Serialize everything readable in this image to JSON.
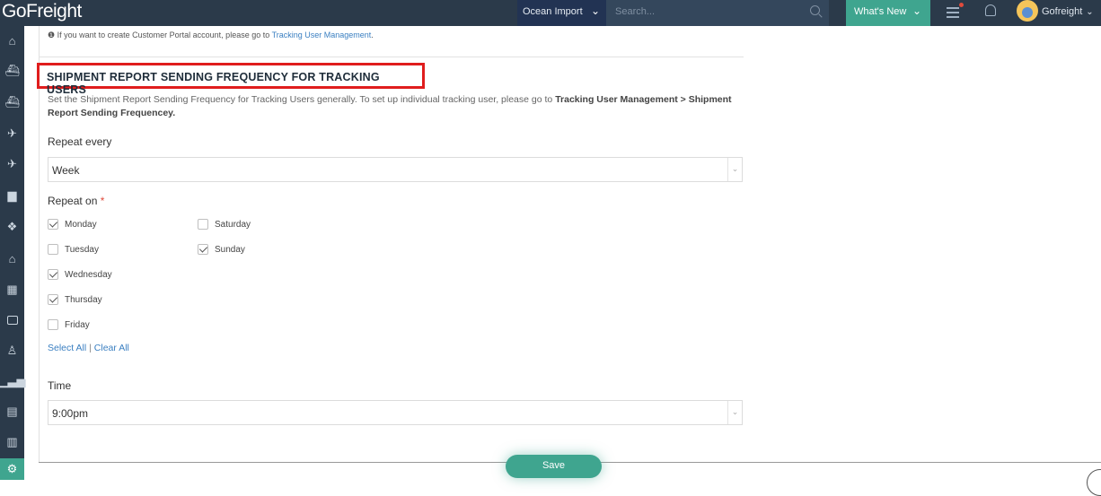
{
  "app": {
    "logo": "GoFreight"
  },
  "header": {
    "mode": "Ocean Import",
    "search_placeholder": "Search...",
    "whats_new": "What's New",
    "username": "Gofreight"
  },
  "sidebar": {
    "items": [
      "home-icon",
      "ocean-export-icon",
      "ocean-import-icon",
      "air-export-icon",
      "air-import-icon",
      "truck-icon",
      "warehouse-icon",
      "building-icon",
      "calculator-icon",
      "briefcase-icon",
      "contacts-icon",
      "report-chart-icon",
      "document-icon",
      "book-icon",
      "gear-icon"
    ]
  },
  "notice": {
    "text": "If you want to create Customer Portal account, please go to ",
    "link": "Tracking User Management",
    "suffix": "."
  },
  "section": {
    "title": "SHIPMENT REPORT SENDING FREQUENCY FOR TRACKING USERS",
    "desc_plain": "Set the Shipment Report Sending Frequency for Tracking Users generally. To set up individual tracking user, please go to ",
    "desc_bold": "Tracking User Management > Shipment Report Sending Frequencey."
  },
  "repeat_every": {
    "label": "Repeat every",
    "value": "Week"
  },
  "repeat_on": {
    "label": "Repeat on",
    "required": "*",
    "days": [
      {
        "label": "Monday",
        "checked": true
      },
      {
        "label": "Tuesday",
        "checked": false
      },
      {
        "label": "Wednesday",
        "checked": true
      },
      {
        "label": "Thursday",
        "checked": true
      },
      {
        "label": "Friday",
        "checked": false
      },
      {
        "label": "Saturday",
        "checked": false
      },
      {
        "label": "Sunday",
        "checked": true
      }
    ],
    "select_all": "Select All",
    "separator": "|",
    "clear_all": "Clear All"
  },
  "time": {
    "label": "Time",
    "value": "9:00pm"
  },
  "actions": {
    "save": "Save"
  },
  "colors": {
    "accent": "#3fa58f",
    "nav": "#2b3a4a",
    "highlight_border": "#e01d1d"
  }
}
